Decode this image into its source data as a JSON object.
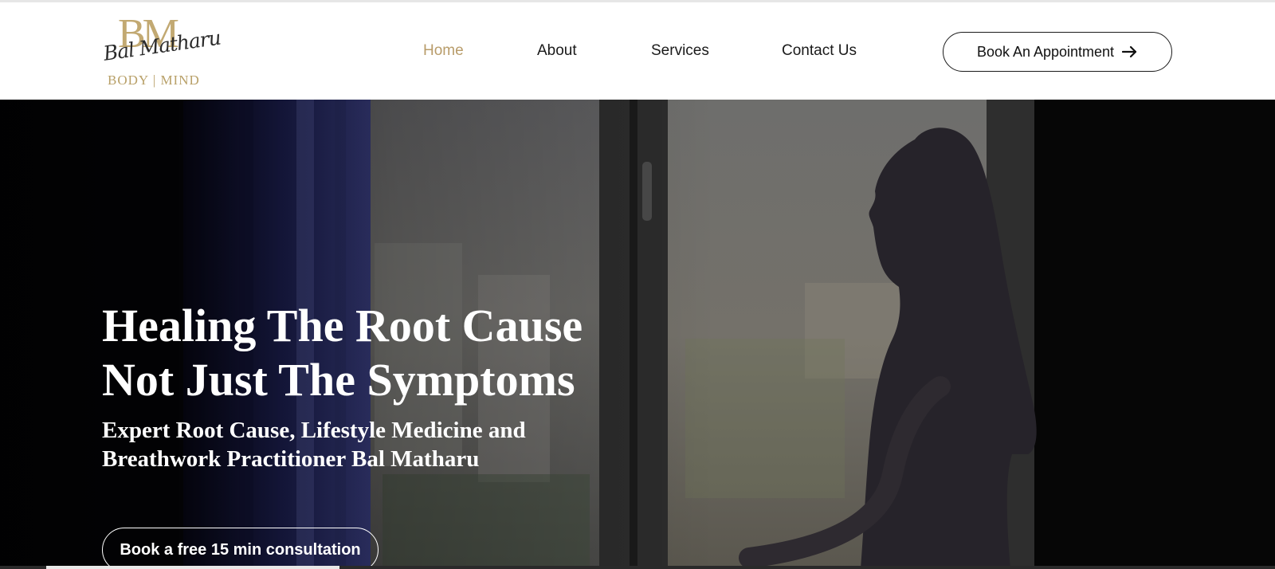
{
  "brand": {
    "monogram": "BM",
    "signature": "Bal Matharu",
    "tagline": "BODY | MIND",
    "gold": "#c2a972"
  },
  "nav": {
    "items": [
      {
        "label": "Home",
        "active": true
      },
      {
        "label": "About",
        "active": false
      },
      {
        "label": "Services",
        "active": false
      },
      {
        "label": "Contact Us",
        "active": false
      }
    ],
    "active_color": "#b89c6a"
  },
  "header": {
    "appointment_label": "Book An Appointment",
    "appointment_icon": "arrow-right-icon"
  },
  "hero": {
    "title_line1": "Healing The Root Cause",
    "title_line2": "Not Just The Symptoms",
    "subtitle_line1": "Expert Root Cause, Lifestyle Medicine and",
    "subtitle_line2": "Breathwork Practitioner Bal Matharu",
    "cta_label": "Book a free 15 min consultation",
    "slide_progress": 0.23
  }
}
